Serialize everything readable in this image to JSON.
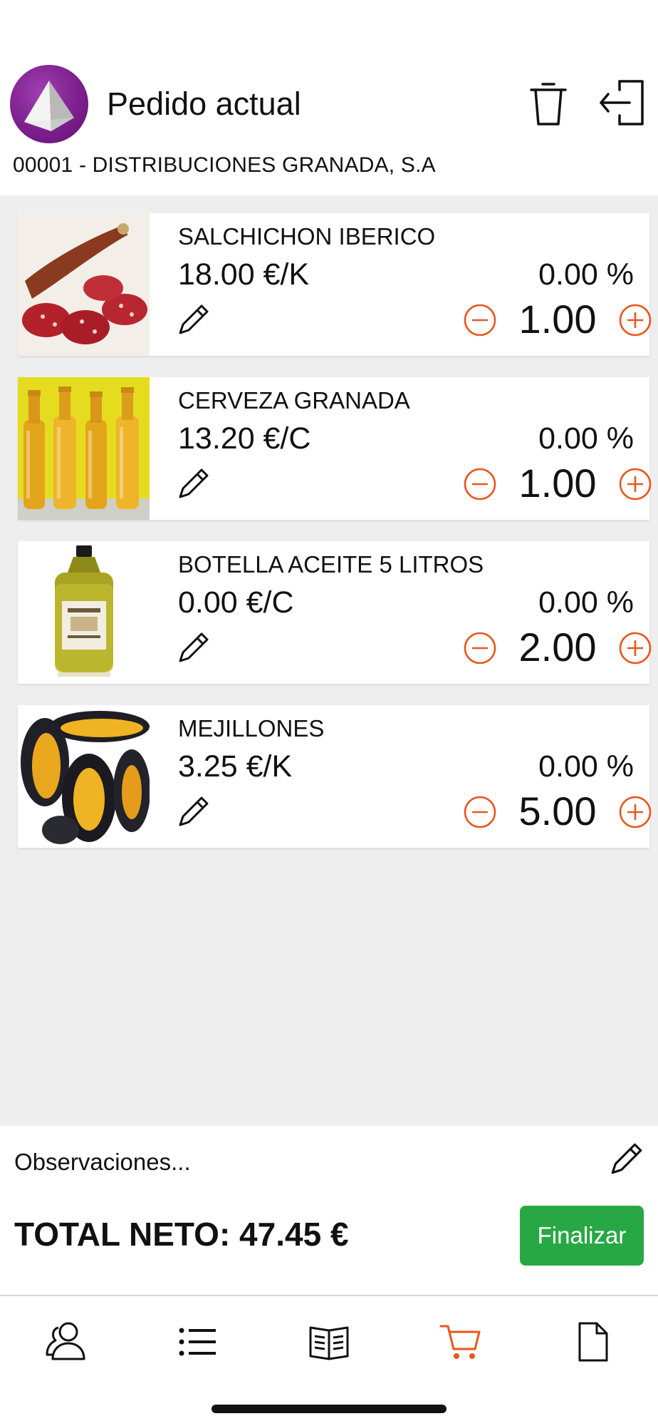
{
  "header": {
    "title": "Pedido actual",
    "client": "00001 - DISTRIBUCIONES GRANADA, S.A",
    "logo_icon": "pyramid-logo-icon",
    "trash_icon": "trash-icon",
    "logout_icon": "logout-icon"
  },
  "products": [
    {
      "name": "SALCHICHON IBERICO",
      "price": "18.00 €/K",
      "discount": "0.00 %",
      "quantity": "1.00"
    },
    {
      "name": "CERVEZA GRANADA",
      "price": "13.20 €/C",
      "discount": "0.00 %",
      "quantity": "1.00"
    },
    {
      "name": "BOTELLA ACEITE 5 LITROS",
      "price": "0.00 €/C",
      "discount": "0.00 %",
      "quantity": "2.00"
    },
    {
      "name": "MEJILLONES",
      "price": "3.25 €/K",
      "discount": "0.00 %",
      "quantity": "5.00"
    }
  ],
  "footer": {
    "observations": "Observaciones...",
    "total": "TOTAL NETO: 47.45 €",
    "finalize_label": "Finalizar"
  },
  "nav": {
    "items": [
      "clients-icon",
      "list-icon",
      "catalog-icon",
      "cart-icon",
      "document-icon"
    ],
    "active": "cart-icon"
  },
  "colors": {
    "accent": "#e8571d",
    "finalize": "#27a844",
    "logo": "#7d1f8e",
    "background": "#eeeeee"
  }
}
